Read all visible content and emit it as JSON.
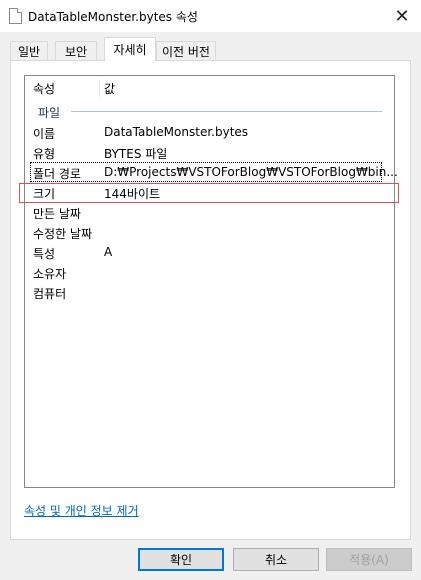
{
  "window": {
    "title": "DataTableMonster.bytes 속성",
    "close_glyph": "✕"
  },
  "tabs": [
    {
      "label": "일반",
      "active": false
    },
    {
      "label": "보안",
      "active": false
    },
    {
      "label": "자세히",
      "active": true
    },
    {
      "label": "이전 버전",
      "active": false
    }
  ],
  "details": {
    "columns": {
      "property": "속성",
      "value": "값"
    },
    "group_label": "파일",
    "rows": [
      {
        "property": "이름",
        "value": "DataTableMonster.bytes"
      },
      {
        "property": "유형",
        "value": "BYTES 파일"
      },
      {
        "property": "폴더 경로",
        "value": "D:₩Projects₩VSTOForBlog₩VSTOForBlog₩bin..."
      },
      {
        "property": "크기",
        "value": "144바이트"
      },
      {
        "property": "만든 날짜",
        "value": ""
      },
      {
        "property": "수정한 날짜",
        "value": ""
      },
      {
        "property": "특성",
        "value": "A"
      },
      {
        "property": "소유자",
        "value": ""
      },
      {
        "property": "컴퓨터",
        "value": ""
      }
    ]
  },
  "remove_link": "속성 및 개인 정보 제거",
  "buttons": {
    "ok": "확인",
    "cancel": "취소",
    "apply": "적용(A)"
  },
  "colors": {
    "highlight_border": "#d9534f",
    "link": "#0066cc",
    "primary_border": "#0078d7"
  }
}
